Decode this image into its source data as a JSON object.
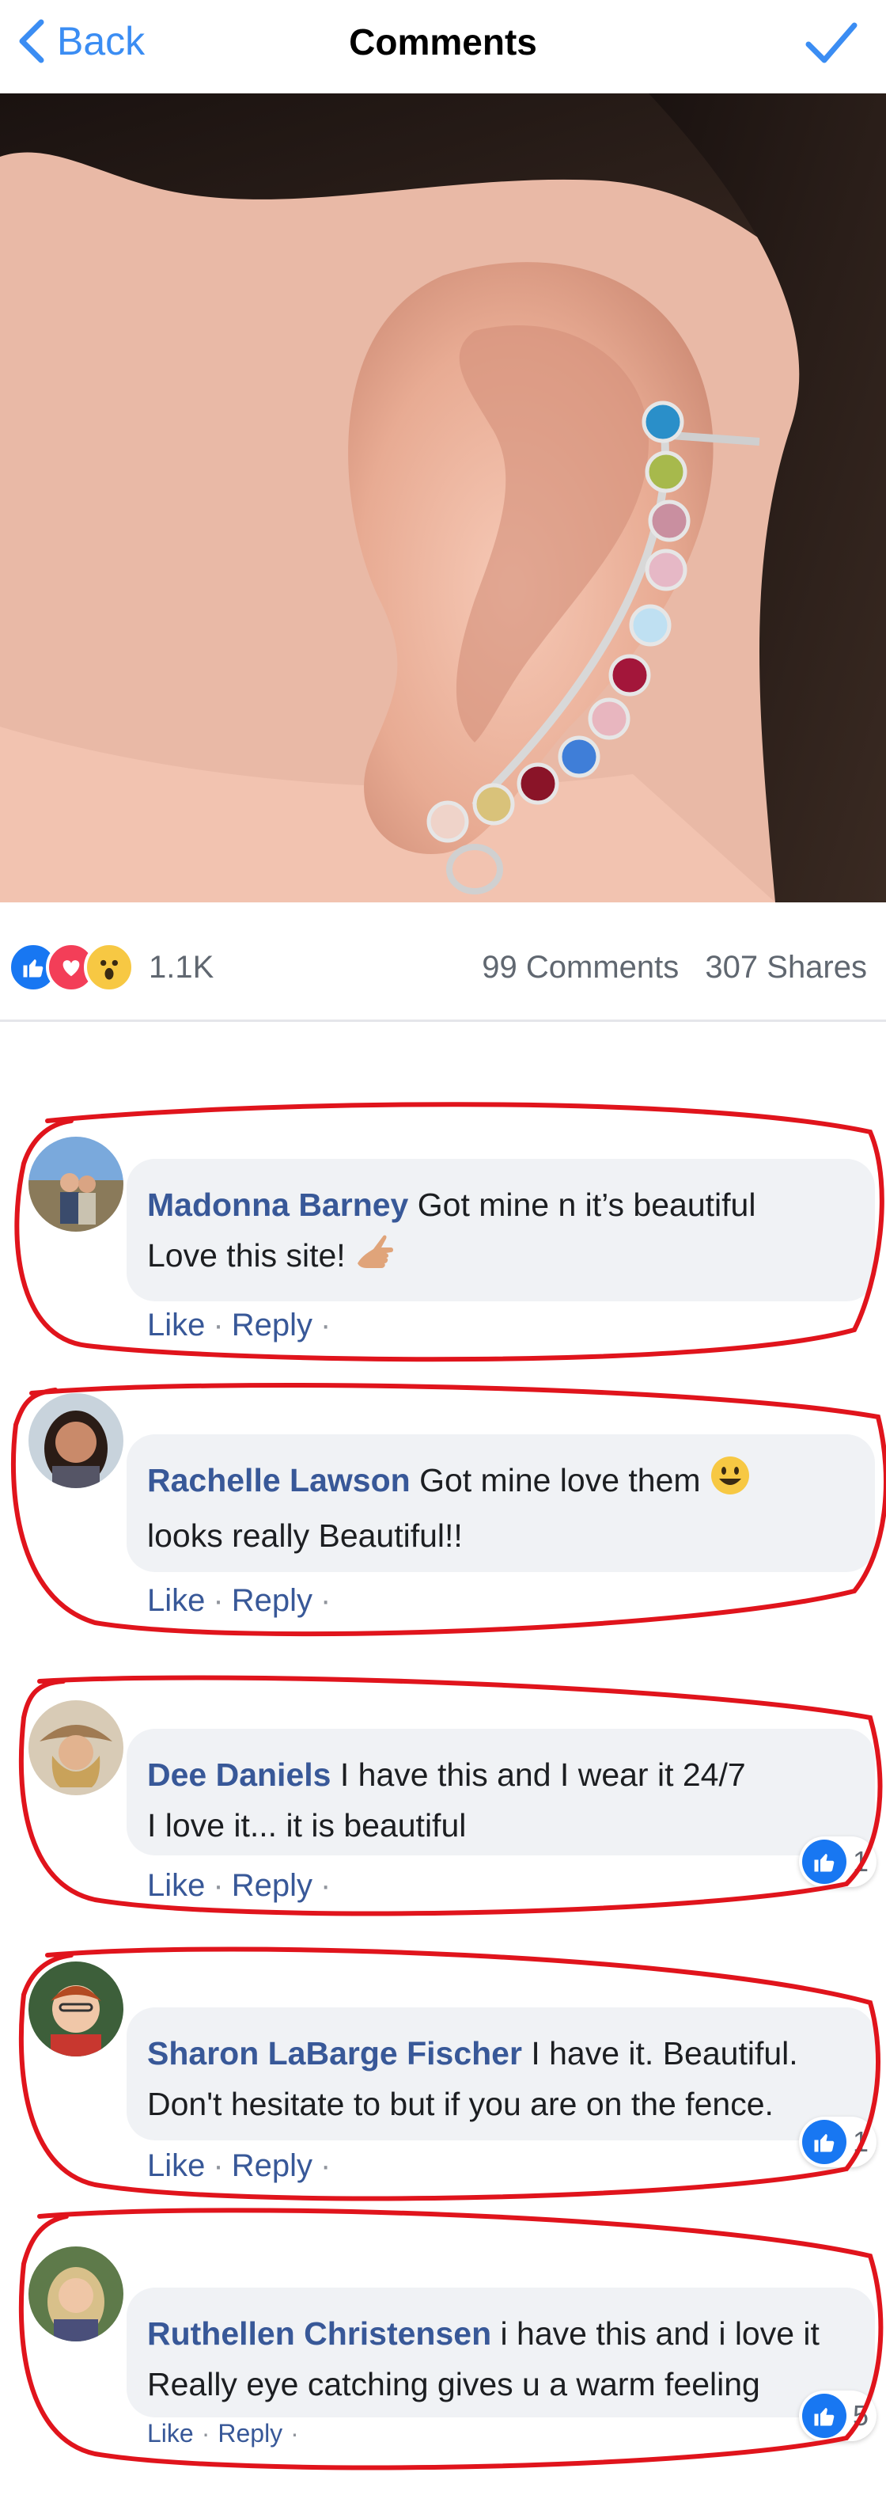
{
  "header": {
    "back_label": "Back",
    "title": "Comments"
  },
  "stats": {
    "reaction_count": "1.1K",
    "comments": "99 Comments",
    "shares": "307 Shares"
  },
  "comments": [
    {
      "name": "Madonna Barney",
      "text_line1": "Got mine n it’s beautiful",
      "text_line2": "Love this site!",
      "like": "Like",
      "reply": "Reply",
      "likes": ""
    },
    {
      "name": "Rachelle Lawson",
      "text_line1": "Got mine love them",
      "text_line2": "looks really Beautiful!!",
      "like": "Like",
      "reply": "Reply",
      "likes": ""
    },
    {
      "name": "Dee Daniels",
      "text_line1": "I have this and I wear it 24/7",
      "text_line2": "I love it... it is beautiful",
      "like": "Like",
      "reply": "Reply",
      "likes": "1"
    },
    {
      "name": "Sharon LaBarge Fischer",
      "text_line1": "I have it. Beautiful.",
      "text_line2": "Don't hesitate to but if you are on the fence.",
      "like": "Like",
      "reply": "Reply",
      "likes": "1"
    },
    {
      "name": "Ruthellen Christensen",
      "text_line1": "i have this and i love it",
      "text_line2": "Really eye catching gives u a warm feeling",
      "like": "Like",
      "reply": "Reply",
      "likes": "5"
    }
  ],
  "colors": {
    "accent": "#3b8df3",
    "name": "#385898",
    "annotation": "#e0141c"
  }
}
